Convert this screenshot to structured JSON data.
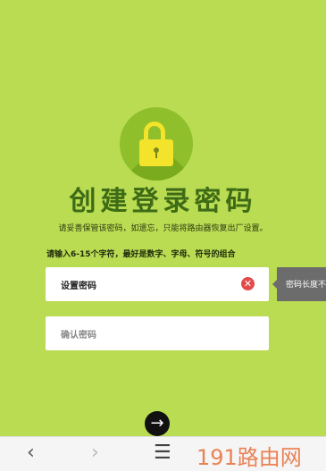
{
  "colors": {
    "background": "#b9dc52",
    "title": "#3e6b15",
    "lock_circle": "#8fbf2b",
    "lock_yellow": "#f3e32a",
    "clear_icon": "#e24b4b",
    "tooltip_bg": "#6c6c6c"
  },
  "header": {
    "title": "创建登录密码",
    "subtitle": "请妥善保管该密码，如遗忘，只能将路由器恢复出厂设置。",
    "instruction": "请输入6-15个字符，最好是数字、字母、符号的组合"
  },
  "form": {
    "password_label": "设置密码",
    "confirm_label": "确认密码",
    "tooltip": "密码长度不"
  },
  "nav": {
    "back_icon": "‹",
    "forward_icon": "›",
    "menu_icon": "☰",
    "next_icon": "→",
    "clear_icon": "✕"
  },
  "watermark": "191路由网"
}
